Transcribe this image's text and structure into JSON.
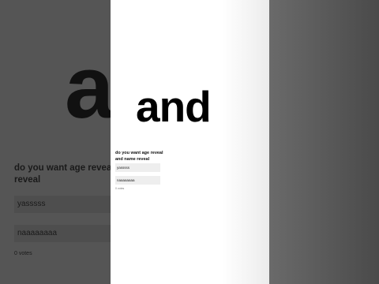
{
  "big_text": "and",
  "poll": {
    "question": "do you want age reveal and name reveal",
    "options": [
      {
        "label": "yasssss"
      },
      {
        "label": "naaaaaaaa"
      }
    ],
    "votes": "0 votes"
  },
  "background": {
    "big_text": "and",
    "question": "do you want age reveal and name reveal",
    "options": [
      "yasssss",
      "naaaaaaaa"
    ],
    "votes": "0 votes"
  },
  "colors": {
    "card": "#ffffff",
    "side_background": "#555555",
    "option_fill": "#eeeeee",
    "text": "#111111"
  }
}
